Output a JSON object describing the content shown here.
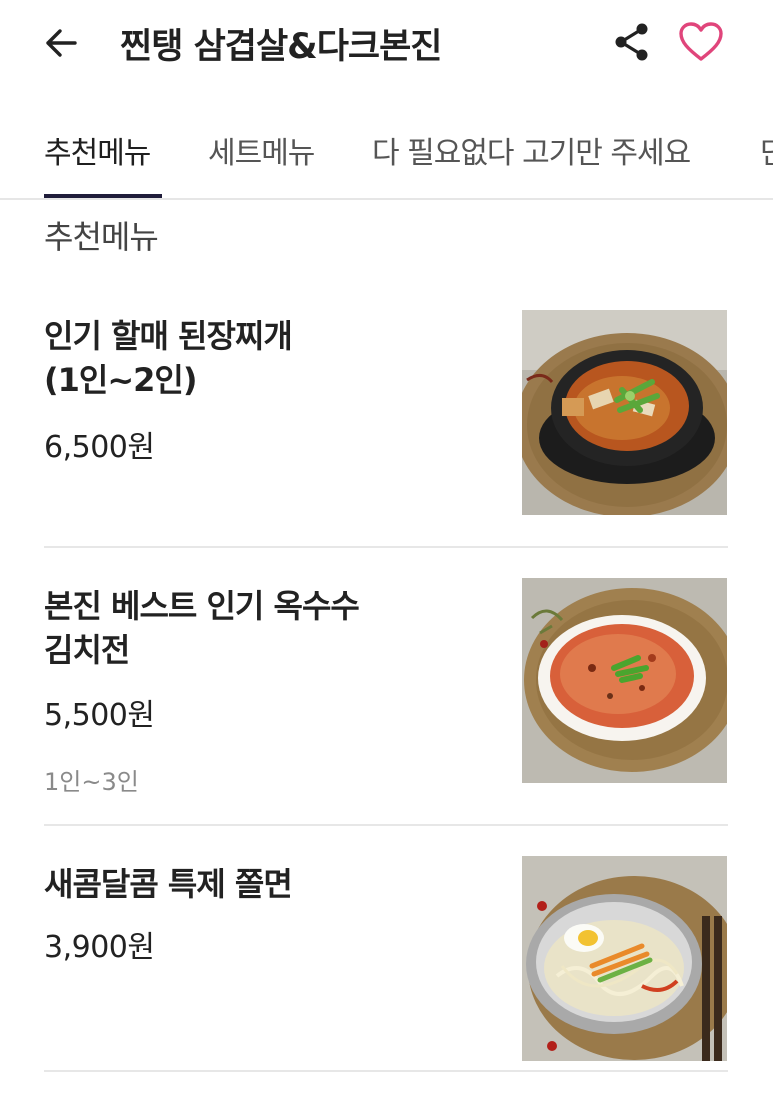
{
  "header": {
    "title": "찐탱 삼겹살&다크본진",
    "back_icon": "arrow-left-icon",
    "share_icon": "share-icon",
    "favorite_icon": "heart-outline-icon",
    "accent_color": "#e0457b"
  },
  "tabs": [
    {
      "label": "추천메뉴",
      "active": true
    },
    {
      "label": "세트메뉴",
      "active": false
    },
    {
      "label": "다 필요없다 고기만 주세요",
      "active": false
    },
    {
      "label": "단",
      "active": false
    }
  ],
  "section": {
    "title": "추천메뉴"
  },
  "items": [
    {
      "name_line1": "인기 할매 된장찌개",
      "name_line2": "(1인~2인)",
      "price": "6,500원",
      "note": "",
      "photo": "doenjang-jjigae-photo"
    },
    {
      "name_line1": "본진 베스트 인기 옥수수",
      "name_line2": "김치전",
      "price": "5,500원",
      "note": "1인~3인",
      "photo": "kimchi-jeon-photo"
    },
    {
      "name_line1": "새콤달콤 특제 쫄면",
      "name_line2": "",
      "price": "3,900원",
      "note": "",
      "photo": "jjolmyeon-photo"
    }
  ]
}
